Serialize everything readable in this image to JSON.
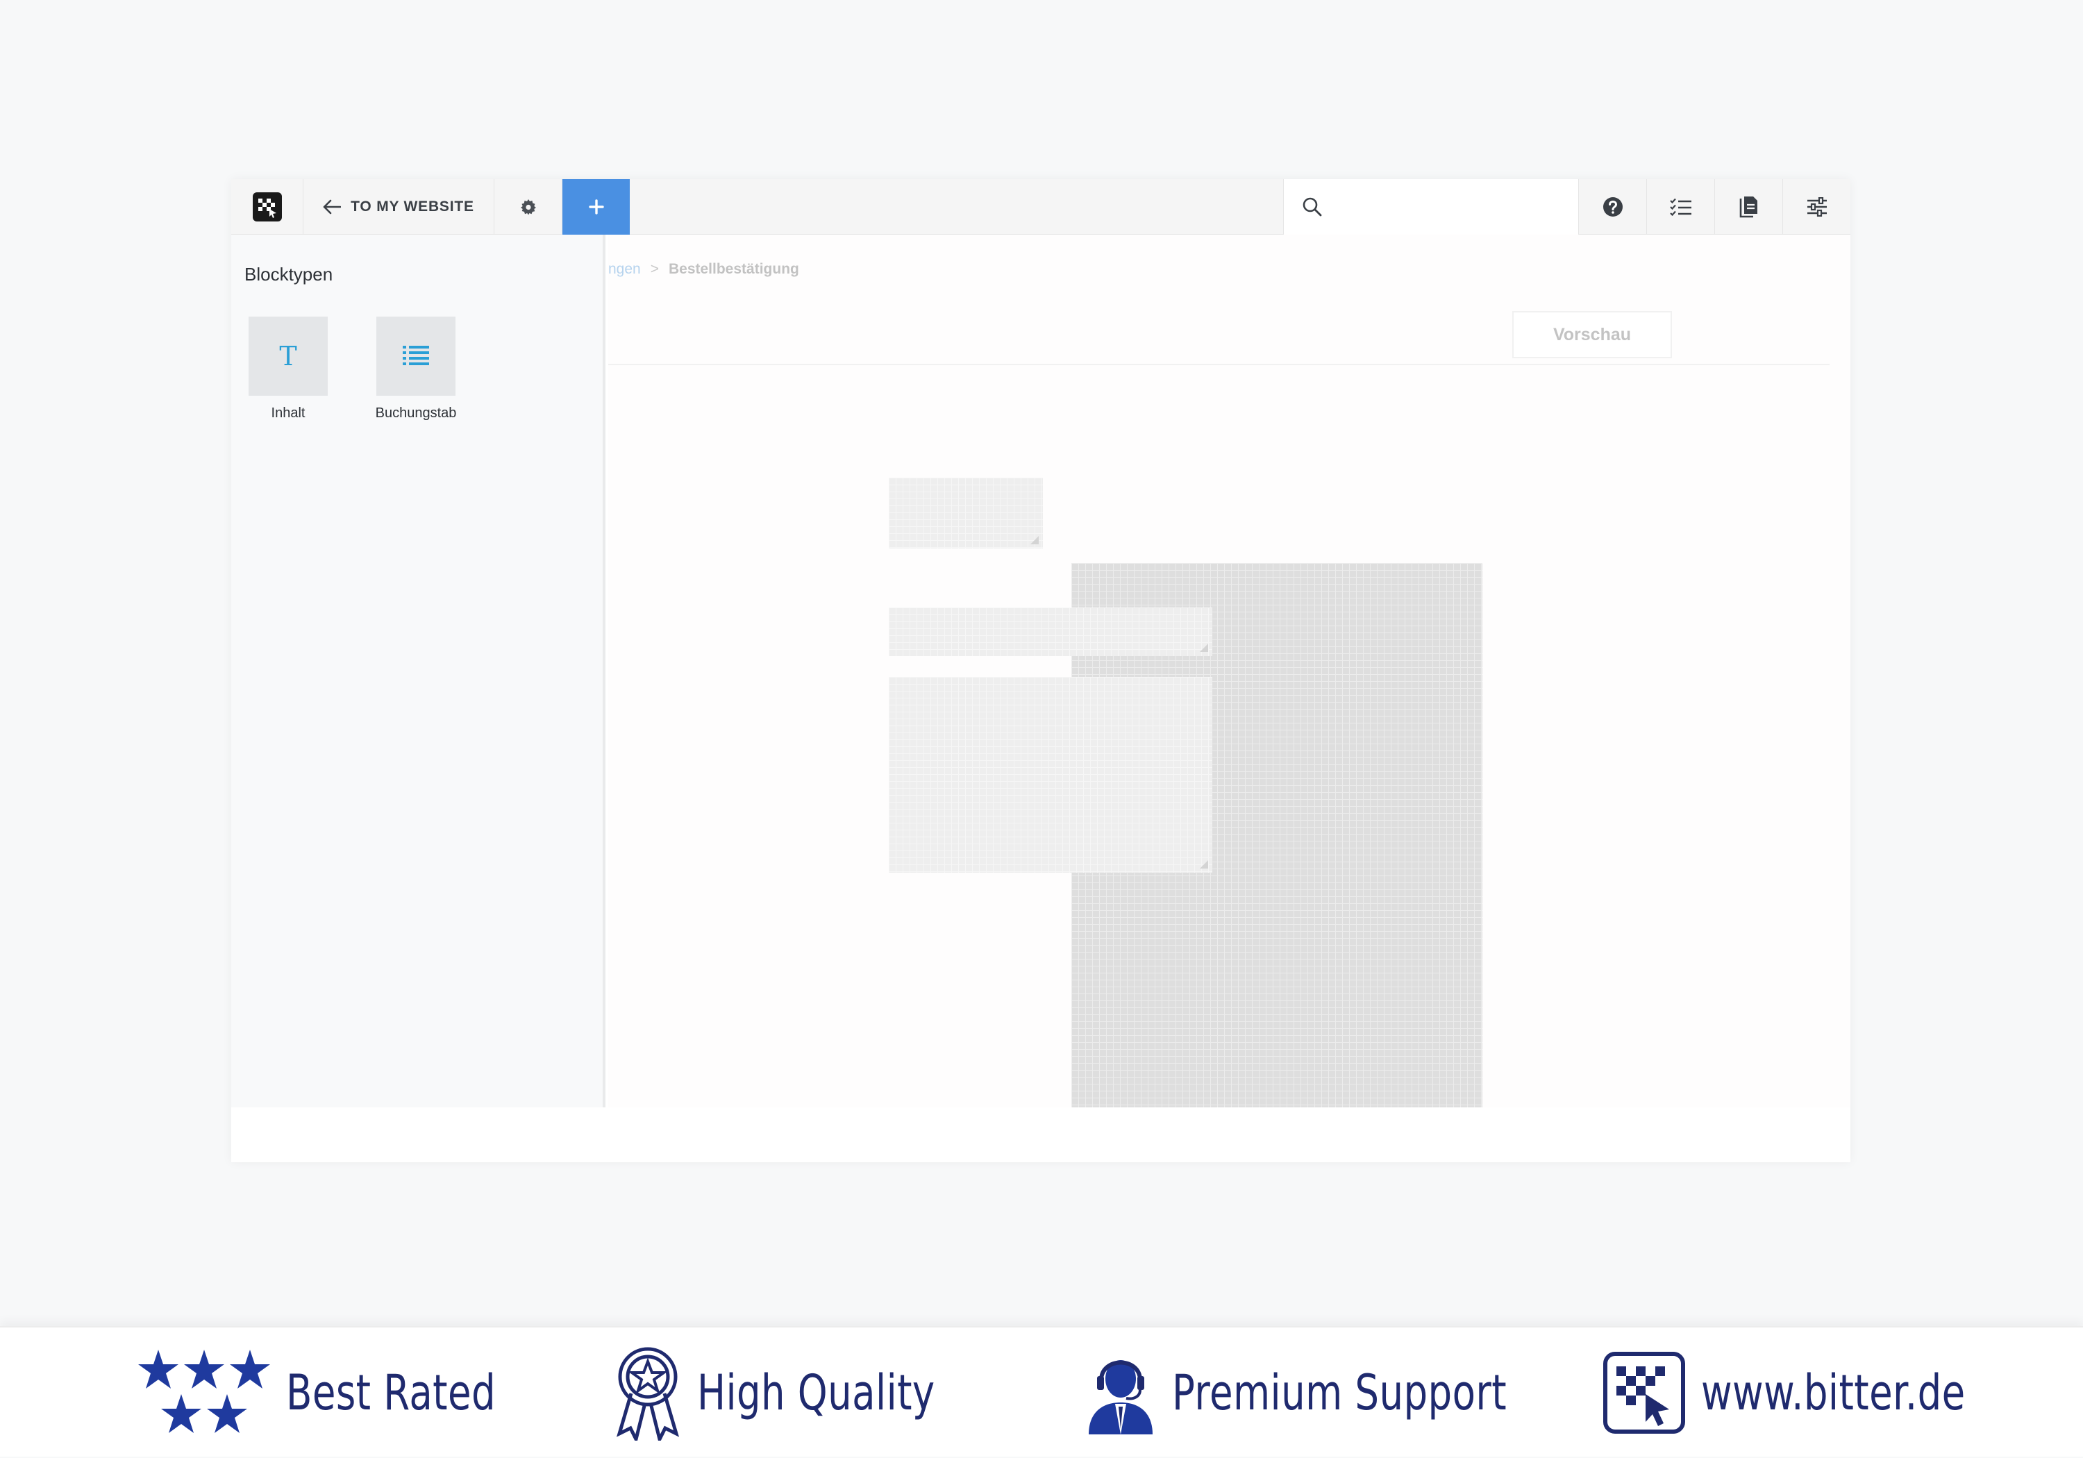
{
  "toolbar": {
    "back_label": "TO MY WEBSITE",
    "search_placeholder": "",
    "accent_color": "#4a90e2",
    "icons": [
      "concrete-logo-icon",
      "arrow-left-icon",
      "gear-icon",
      "plus-icon",
      "search-icon",
      "help-icon",
      "checklist-icon",
      "pages-icon",
      "sliders-icon"
    ]
  },
  "panel": {
    "title": "Blocktypen",
    "block_types": [
      {
        "label": "Inhalt",
        "icon": "text-t-icon"
      },
      {
        "label": "Buchungstab",
        "icon": "list-icon"
      }
    ]
  },
  "main": {
    "breadcrumb": [
      "ngen",
      ">",
      "Bestellbestätigung"
    ],
    "preview_label": "Vorschau"
  },
  "footer": {
    "text_color": "#1f2a6e",
    "badges": [
      {
        "label": "Best Rated",
        "icon": "stars-icon"
      },
      {
        "label": "High Quality",
        "icon": "award-ribbon-icon"
      },
      {
        "label": "Premium Support",
        "icon": "support-agent-icon"
      },
      {
        "label": "www.bitter.de",
        "icon": "bitter-logo-icon"
      }
    ]
  }
}
